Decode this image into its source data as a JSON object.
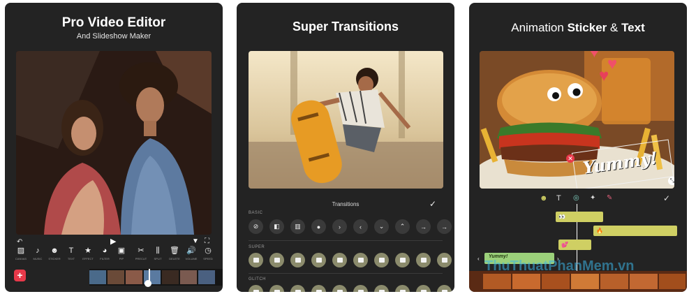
{
  "panel1": {
    "title": "Pro Video Editor",
    "subtitle": "And Slideshow Maker",
    "tools": [
      {
        "icon": "hatch-icon",
        "glyph": "▨",
        "label": "CANVAS"
      },
      {
        "icon": "music-note-icon",
        "glyph": "♪",
        "label": "MUSIC"
      },
      {
        "icon": "sticker-icon",
        "glyph": "☻",
        "label": "STICKER"
      },
      {
        "icon": "text-icon",
        "glyph": "T",
        "label": "TEXT"
      },
      {
        "icon": "star-icon",
        "glyph": "★",
        "label": "EFFECT"
      },
      {
        "icon": "palette-icon",
        "glyph": "◕",
        "label": "FILTER"
      },
      {
        "icon": "pip-icon",
        "glyph": "▣",
        "label": "PIP"
      },
      {
        "icon": "scissors-icon",
        "glyph": "✂",
        "label": "PRECUT"
      },
      {
        "icon": "split-icon",
        "glyph": "⫼",
        "label": "SPLIT"
      },
      {
        "icon": "delete-icon",
        "glyph": "🗑",
        "label": "DELETE"
      },
      {
        "icon": "volume-icon",
        "glyph": "🔊",
        "label": "VOLUME"
      },
      {
        "icon": "speed-icon",
        "glyph": "◷",
        "label": "SPEED"
      }
    ],
    "add_button": "+"
  },
  "panel2": {
    "title": "Super Transitions",
    "header_label": "Transitions",
    "confirm_icon": "checkmark-icon",
    "sections": [
      {
        "name": "BASIC",
        "buttons": [
          "⊘",
          "◧",
          "▥",
          "●",
          "›",
          "‹",
          "⌄",
          "⌃",
          "→",
          "→"
        ]
      },
      {
        "name": "SUPER",
        "buttons": [
          "",
          "",
          "",
          "",
          "",
          "",
          "",
          "",
          "",
          ""
        ]
      },
      {
        "name": "GLITCH",
        "buttons": [
          "",
          "",
          "",
          "",
          "",
          "",
          "",
          "",
          "",
          ""
        ]
      }
    ]
  },
  "panel3": {
    "title_plain_1": "Animation ",
    "title_bold_1": "Sticker",
    "title_plain_2": " & ",
    "title_bold_2": "Text",
    "sticker_text": "Yummy!",
    "timeline_label": "Yummy!",
    "watermark": "ThuThuatPhanMem.vn",
    "toolbar_icons": [
      "sticker-icon",
      "text-icon",
      "gif-icon",
      "magic-icon",
      "erase-icon"
    ],
    "accent": "#cfcf63",
    "heart_color": "#f0506a"
  }
}
